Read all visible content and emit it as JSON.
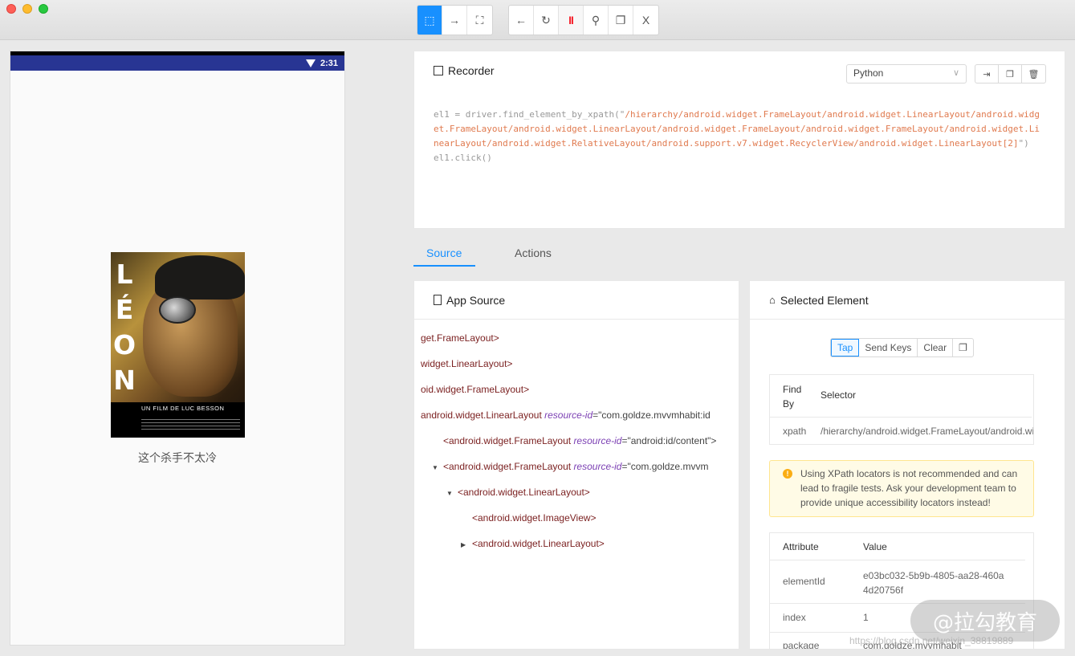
{
  "toolbar": {
    "mode_buttons": [
      {
        "icon": "select-element-icon",
        "glyph": "⬚",
        "active": true
      },
      {
        "icon": "swipe-arrow-icon",
        "glyph": "→",
        "active": false
      },
      {
        "icon": "tap-coordinates-icon",
        "glyph": "⛶",
        "active": false
      }
    ],
    "action_buttons": [
      {
        "icon": "back-arrow-icon",
        "glyph": "←"
      },
      {
        "icon": "refresh-icon",
        "glyph": "↻"
      },
      {
        "icon": "pause-recording-icon",
        "glyph": "II"
      },
      {
        "icon": "search-icon",
        "glyph": "⚲"
      },
      {
        "icon": "copy-icon",
        "glyph": "❐"
      },
      {
        "icon": "close-icon",
        "glyph": "X"
      }
    ]
  },
  "device": {
    "time": "2:31",
    "poster": {
      "title_letters": [
        "L",
        "É",
        "O",
        "N"
      ],
      "credit": "UN FILM DE LUC BESSON"
    },
    "movie_title": "这个杀手不太冷"
  },
  "recorder": {
    "title": "Recorder",
    "language": "Python",
    "code_prefix": "el1 = driver.find_element_by_xpath(\"",
    "code_string": "/hierarchy/android.widget.FrameLayout/android.widget.LinearLayout/android.widget.FrameLayout/android.widget.LinearLayout/android.widget.FrameLayout/android.widget.FrameLayout/android.widget.LinearLayout/android.widget.RelativeLayout/android.support.v7.widget.RecyclerView/android.widget.LinearLayout[2]",
    "code_suffix": "\")\nel1.click()"
  },
  "tabs": [
    "Source",
    "Actions"
  ],
  "app_source": {
    "title": "App Source",
    "nodes": [
      {
        "caret": "",
        "tag": "get.FrameLayout>",
        "attr": "",
        "val": ""
      },
      {
        "caret": "",
        "tag": "widget.LinearLayout>",
        "attr": "",
        "val": ""
      },
      {
        "caret": "",
        "tag": "oid.widget.FrameLayout>",
        "attr": "",
        "val": ""
      },
      {
        "caret": "",
        "tag": "android.widget.LinearLayout ",
        "attr": "resource-id",
        "val": "\"com.goldze.mvvmhabit:id"
      },
      {
        "caret": "",
        "tag": "<android.widget.FrameLayout ",
        "attr": "resource-id",
        "val": "\"android:id/content\">"
      },
      {
        "caret": "▼",
        "tag": "<android.widget.FrameLayout ",
        "attr": "resource-id",
        "val": "\"com.goldze.mvvm"
      },
      {
        "caret": "▼",
        "tag": "<android.widget.LinearLayout>",
        "attr": "",
        "val": ""
      },
      {
        "caret": "",
        "tag": "<android.widget.ImageView>",
        "attr": "",
        "val": ""
      },
      {
        "caret": "▶",
        "tag": "<android.widget.LinearLayout>",
        "attr": "",
        "val": ""
      }
    ]
  },
  "selected_element": {
    "title": "Selected Element",
    "buttons": [
      "Tap",
      "Send Keys",
      "Clear"
    ],
    "find_by_header": "Find By",
    "selector_header": "Selector",
    "find_by": "xpath",
    "selector": "/hierarchy/android.widget.FrameLayout/android.widget.LinearLayout",
    "warning": "Using XPath locators is not recommended and can lead to fragile tests. Ask your development team to provide unique accessibility locators instead!",
    "attribute_header": "Attribute",
    "value_header": "Value",
    "attributes": [
      {
        "name": "elementId",
        "value": "e03bc032-5b9b-4805-aa28-460a4d20756f"
      },
      {
        "name": "index",
        "value": "1"
      },
      {
        "name": "package",
        "value": "com.goldze.mvvmhabit"
      }
    ]
  },
  "watermark": {
    "brand": "@拉勾教育",
    "url": "https://blog.csdn.net/weixin_38819889"
  },
  "colors": {
    "accent": "#1890ff",
    "statusbar": "#283593",
    "xml_tag": "#7a1f1f",
    "xml_attr": "#7b3fb3",
    "code_string": "#e07a4f"
  }
}
